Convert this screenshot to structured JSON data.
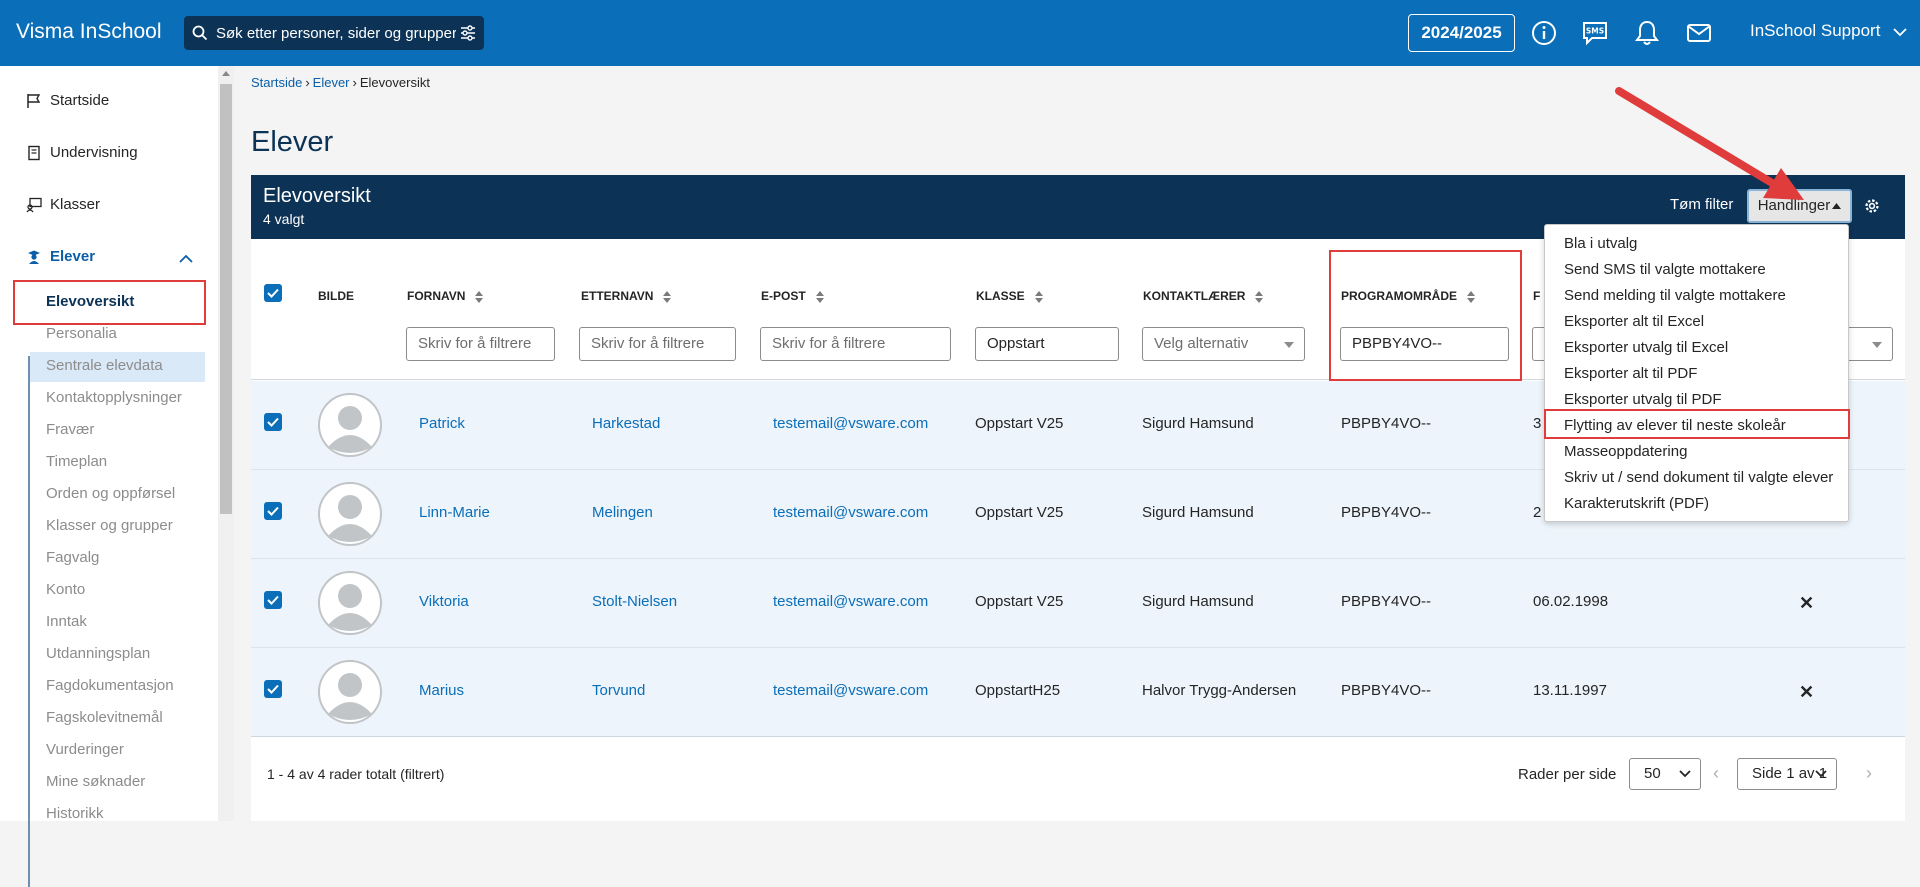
{
  "app": {
    "title": "Visma InSchool"
  },
  "search": {
    "placeholder": "Søk etter personer, sider og grupper"
  },
  "header": {
    "year": "2024/2025",
    "user": "InSchool Support"
  },
  "sidebar": {
    "items": [
      {
        "label": "Startside",
        "icon": "flag-icon"
      },
      {
        "label": "Undervisning",
        "icon": "book-icon"
      },
      {
        "label": "Klasser",
        "icon": "classroom-icon"
      },
      {
        "label": "Elever",
        "icon": "student-icon"
      }
    ],
    "subitems": [
      "Elevoversikt",
      "Personalia",
      "Sentrale elevdata",
      "Kontaktopplysninger",
      "Fravær",
      "Timeplan",
      "Orden og oppførsel",
      "Klasser og grupper",
      "Fagvalg",
      "Konto",
      "Inntak",
      "Utdanningsplan",
      "Fagdokumentasjon",
      "Fagskolevitnemål",
      "Vurderinger",
      "Mine søknader",
      "Historikk"
    ]
  },
  "breadcrumb": [
    "Startside",
    "Elever",
    "Elevoversikt"
  ],
  "page": {
    "title": "Elever"
  },
  "card": {
    "title": "Elevoversikt",
    "subtitle": "4 valgt",
    "clear_filter": "Tøm filter",
    "actions": "Handlinger"
  },
  "table": {
    "columns": [
      "BILDE",
      "FORNAVN",
      "ETTERNAVN",
      "E-POST",
      "KLASSE",
      "KONTAKTLÆRER",
      "PROGRAMOMRÅDE",
      "F"
    ],
    "filters": {
      "fornavn": "Skriv for å filtrere",
      "etternavn": "Skriv for å filtrere",
      "epost": "Skriv for å filtrere",
      "klasse": "Oppstart",
      "kontaktlaerer": "Velg alternativ",
      "programomrade": "PBPBY4VO--"
    },
    "rows": [
      {
        "fornavn": "Patrick",
        "etternavn": "Harkestad",
        "epost": "testemail@vsware.com",
        "klasse": "Oppstart V25",
        "kontaktlaerer": "Sigurd Hamsund",
        "programomrade": "PBPBY4VO--",
        "fodsel": "3",
        "x": ""
      },
      {
        "fornavn": "Linn-Marie",
        "etternavn": "Melingen",
        "epost": "testemail@vsware.com",
        "klasse": "Oppstart V25",
        "kontaktlaerer": "Sigurd Hamsund",
        "programomrade": "PBPBY4VO--",
        "fodsel": "2",
        "x": ""
      },
      {
        "fornavn": "Viktoria",
        "etternavn": "Stolt-Nielsen",
        "epost": "testemail@vsware.com",
        "klasse": "Oppstart V25",
        "kontaktlaerer": "Sigurd Hamsund",
        "programomrade": "PBPBY4VO--",
        "fodsel": "06.02.1998",
        "x": "✕"
      },
      {
        "fornavn": "Marius",
        "etternavn": "Torvund",
        "epost": "testemail@vsware.com",
        "klasse": "OppstartH25",
        "kontaktlaerer": "Halvor Trygg-Andersen",
        "programomrade": "PBPBY4VO--",
        "fodsel": "13.11.1997",
        "x": "✕"
      }
    ]
  },
  "footer": {
    "count": "1 - 4 av 4 rader totalt (filtrert)",
    "rows_label": "Rader per side",
    "rows_value": "50",
    "page_value": "Side 1 av 1"
  },
  "dropdown": {
    "items": [
      "Bla i utvalg",
      "Send SMS til valgte mottakere",
      "Send melding til valgte mottakere",
      "Eksporter alt til Excel",
      "Eksporter utvalg til Excel",
      "Eksporter alt til PDF",
      "Eksporter utvalg til PDF",
      "Flytting av elever til neste skoleår",
      "Masseoppdatering",
      "Skriv ut / send dokument til valgte elever",
      "Karakterutskrift (PDF)"
    ],
    "highlighted": "Flytting av elever til neste skoleår"
  },
  "colors": {
    "header": "#0b6eb8",
    "card_header": "#0c3356",
    "highlight": "#e03c3c",
    "row_bg": "#edf4fb",
    "link": "#0b6eb8"
  }
}
